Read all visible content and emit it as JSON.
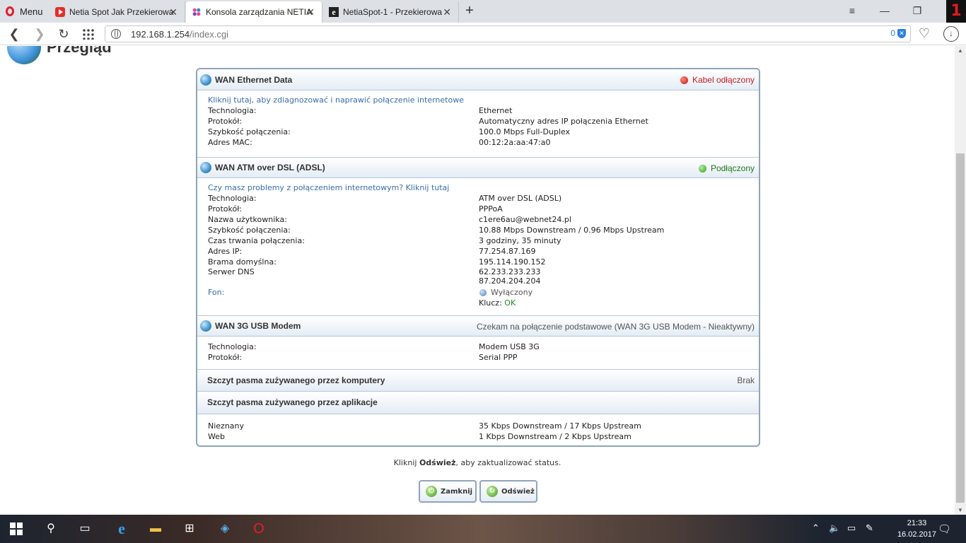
{
  "browser": {
    "menu_label": "Menu",
    "tabs": [
      {
        "title": "Netia Spot Jak Przekierowa",
        "icon": "youtube-icon"
      },
      {
        "title": "Konsola zarządzania NETIA",
        "icon": "netia-icon"
      },
      {
        "title": "NetiaSpot-1 - Przekierowa",
        "icon": "edge-e-icon"
      }
    ],
    "url_host": "192.168.1.254",
    "url_path": "/index.cgi",
    "adblock_count": "0",
    "notification_badge": "1"
  },
  "page": {
    "title": "Przegląd",
    "sections": {
      "wan_ethernet": {
        "title": "WAN Ethernet Data",
        "status": "Kabel odłączony",
        "link": "Kliknij tutaj, aby zdiagnozować i naprawić połączenie internetowe",
        "rows": [
          {
            "k": "Technologia:",
            "v": "Ethernet"
          },
          {
            "k": "Protokół:",
            "v": "Automatyczny adres IP połączenia Ethernet"
          },
          {
            "k": "Szybkość połączenia:",
            "v": "100.0 Mbps Full-Duplex"
          },
          {
            "k": "Adres MAC:",
            "v": "00:12:2a:aa:47:a0"
          }
        ]
      },
      "wan_adsl": {
        "title": "WAN ATM over DSL (ADSL)",
        "status": "Podłączony",
        "link": "Czy masz problemy z połączeniem internetowym? Kliknij tutaj",
        "rows": [
          {
            "k": "Technologia:",
            "v": "ATM over DSL (ADSL)"
          },
          {
            "k": "Protokół:",
            "v": "PPPoA"
          },
          {
            "k": "Nazwa użytkownika:",
            "v": "c1ere6au@webnet24.pl"
          },
          {
            "k": "Szybkość połączenia:",
            "v": "10.88 Mbps Downstream / 0.96 Mbps Upstream"
          },
          {
            "k": "Czas trwania połączenia:",
            "v": "3 godziny, 35 minuty"
          },
          {
            "k": "Adres IP:",
            "v": "77.254.87.169"
          },
          {
            "k": "Brama domyślna:",
            "v": "195.114.190.152"
          }
        ],
        "dns_label": "Serwer DNS",
        "dns1": "62.233.233.233",
        "dns2": "87.204.204.204",
        "fon_label": "Fon:",
        "fon_status": "Wyłączony",
        "key_label": "Klucz:",
        "key_value": "OK"
      },
      "wan_3g": {
        "title": "WAN 3G USB Modem",
        "status": "Czekam na połączenie podstawowe (WAN 3G USB Modem - Nieaktywny)",
        "rows": [
          {
            "k": "Technologia:",
            "v": "Modem USB 3G"
          },
          {
            "k": "Protokół:",
            "v": "Serial PPP"
          }
        ]
      },
      "peak_computers": {
        "title": "Szczyt pasma zużywanego przez komputery",
        "value": "Brak"
      },
      "peak_apps": {
        "title": "Szczyt pasma zużywanego przez aplikacje",
        "rows": [
          {
            "k": "Nieznany",
            "v": "35 Kbps Downstream / 17 Kbps Upstream"
          },
          {
            "k": "Web",
            "v": "1 Kbps Downstream / 2 Kbps Upstream"
          }
        ]
      }
    },
    "hint_pre": "Kliknij ",
    "hint_bold": "Odśwież",
    "hint_post": ", aby zaktualizować status.",
    "close_button": "Zamknij",
    "refresh_button": "Odśwież"
  },
  "taskbar": {
    "time": "21:33",
    "date": "16.02.2017"
  },
  "colors": {
    "status_disconnected": "#c02020",
    "status_connected": "#1f7a1f",
    "panel_border": "#8fa4bd"
  }
}
